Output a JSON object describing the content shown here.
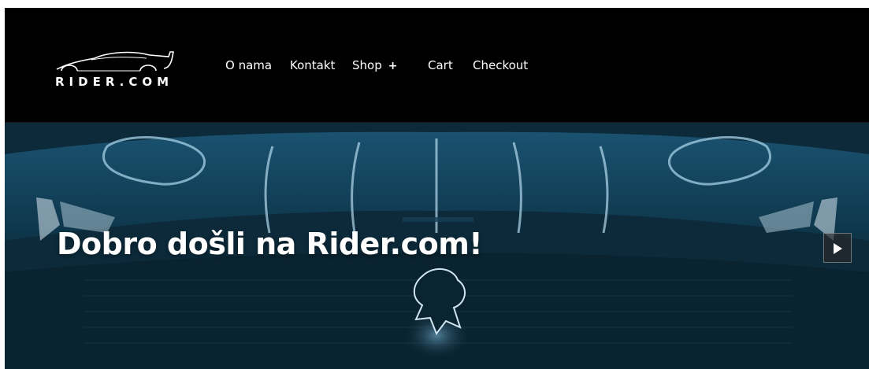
{
  "brand": {
    "logo_text": "RIDER.COM"
  },
  "nav": {
    "items": [
      {
        "label": "O nama"
      },
      {
        "label": "Kontakt"
      },
      {
        "label": "Shop",
        "suffix": "+"
      },
      {
        "label": "Cart"
      },
      {
        "label": "Checkout"
      }
    ]
  },
  "hero": {
    "title": "Dobro došli na Rider.com!",
    "next_icon": "play-right-icon"
  },
  "colors": {
    "header_bg": "#000000",
    "hero_tint": "#10384c",
    "text": "#ffffff"
  }
}
